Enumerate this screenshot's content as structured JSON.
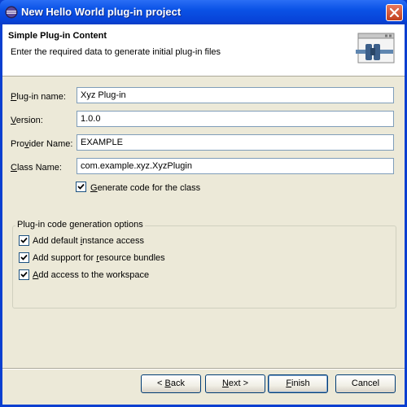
{
  "window": {
    "title": "New Hello World plug-in project"
  },
  "header": {
    "title": "Simple Plug-in Content",
    "description": "Enter the required data to generate initial plug-in files"
  },
  "form": {
    "plugin_name": {
      "label_pre": "",
      "label_mnemonic": "P",
      "label_post": "lug-in name:",
      "value": "Xyz Plug-in"
    },
    "version": {
      "label_pre": "",
      "label_mnemonic": "V",
      "label_post": "ersion:",
      "value": "1.0.0"
    },
    "provider": {
      "label_pre": "Pro",
      "label_mnemonic": "v",
      "label_post": "ider Name:",
      "value": "EXAMPLE"
    },
    "class_name": {
      "label_pre": "",
      "label_mnemonic": "C",
      "label_post": "lass Name:",
      "value": "com.example.xyz.XyzPlugin"
    },
    "generate_code": {
      "label_pre": "",
      "label_mnemonic": "G",
      "label_post": "enerate code for the class",
      "checked": true
    }
  },
  "options": {
    "title": "Plug-in code generation options",
    "items": [
      {
        "label_pre": "Add default ",
        "label_mnemonic": "i",
        "label_post": "nstance access",
        "checked": true
      },
      {
        "label_pre": "Add support for ",
        "label_mnemonic": "r",
        "label_post": "esource bundles",
        "checked": true
      },
      {
        "label_pre": "",
        "label_mnemonic": "A",
        "label_post": "dd access to the workspace",
        "checked": true
      }
    ]
  },
  "buttons": {
    "back": {
      "pre": "< ",
      "mnemonic": "B",
      "post": "ack"
    },
    "next": {
      "pre": "",
      "mnemonic": "N",
      "post": "ext >"
    },
    "finish": {
      "pre": "",
      "mnemonic": "F",
      "post": "inish"
    },
    "cancel": "Cancel"
  },
  "icons": {
    "app": "eclipse-icon",
    "close": "close-icon",
    "wizard": "plugin-wizard-icon",
    "check": "checkmark-icon"
  },
  "colors": {
    "titlebar": "#0a52e6",
    "dialog_bg": "#ece9d8",
    "input_border": "#7f9db9",
    "close_button": "#d65c3b"
  }
}
